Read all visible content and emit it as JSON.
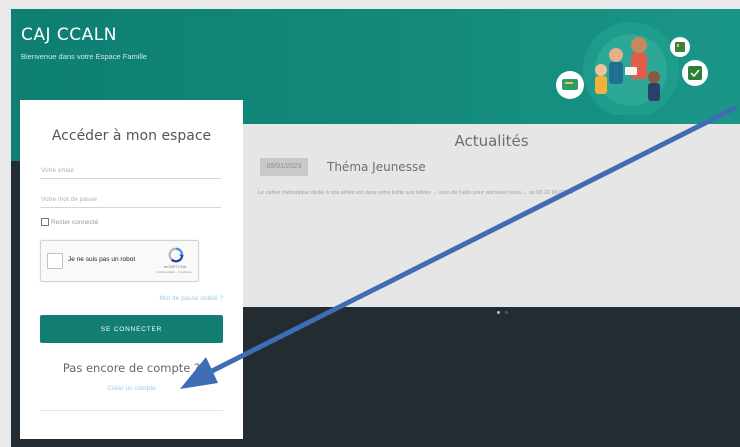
{
  "header": {
    "title": "CAJ CCALN",
    "subtitle": "Bienvenue dans votre Espace Famille"
  },
  "login": {
    "title": "Accéder à mon espace",
    "email_placeholder": "Votre email",
    "password_placeholder": "Votre mot de passe",
    "remember_label": "Rester connecté",
    "captcha_label": "Je ne suis pas un robot",
    "captcha_brand": "reCAPTCHA",
    "captcha_terms": "Confidentialité - Conditions",
    "forgot_label": "Mot de passe oublié ?",
    "submit_label": "SE CONNECTER",
    "no_account_label": "Pas encore de compte ?",
    "create_account_label": "Créer un compte"
  },
  "news": {
    "title": "Actualités",
    "date": "09/01/2023",
    "heading": "Théma Jeunesse",
    "snippet": "Le cahier thématique dédié à nos aînés est dans votre boîte aux lettres ... voici de l'aide pour retrouver leurs ... au 03 22 99 03 73"
  },
  "colors": {
    "header_teal": "#0e7f72",
    "button_teal": "#127e74",
    "annotation_arrow": "#3f6db4"
  },
  "icons": {
    "illustration": "family-people-illustration",
    "recaptcha": "recaptcha-logo",
    "annotation": "annotation-arrow-icon"
  }
}
